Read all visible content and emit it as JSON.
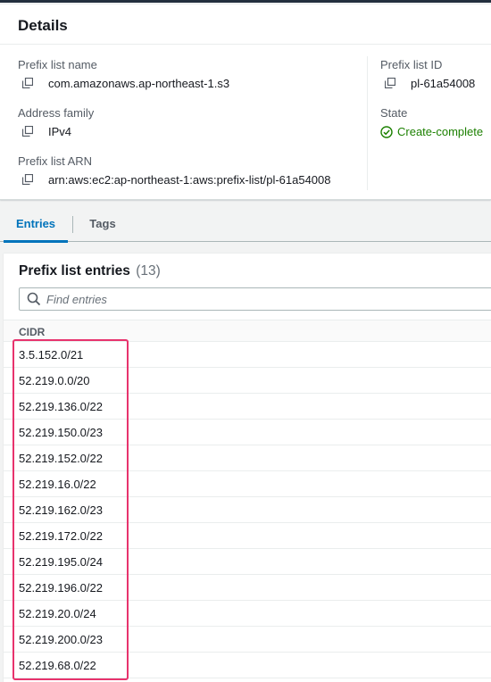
{
  "details": {
    "title": "Details",
    "prefix_list_name_label": "Prefix list name",
    "prefix_list_name": "com.amazonaws.ap-northeast-1.s3",
    "address_family_label": "Address family",
    "address_family": "IPv4",
    "prefix_list_arn_label": "Prefix list ARN",
    "prefix_list_arn": "arn:aws:ec2:ap-northeast-1:aws:prefix-list/pl-61a54008",
    "prefix_list_id_label": "Prefix list ID",
    "prefix_list_id": "pl-61a54008",
    "state_label": "State",
    "state": "Create-complete"
  },
  "tabs": [
    {
      "label": "Entries",
      "active": true
    },
    {
      "label": "Tags",
      "active": false
    }
  ],
  "entries": {
    "title": "Prefix list entries",
    "count": "(13)",
    "search_placeholder": "Find entries",
    "column_header": "CIDR",
    "rows": [
      "3.5.152.0/21",
      "52.219.0.0/20",
      "52.219.136.0/22",
      "52.219.150.0/23",
      "52.219.152.0/22",
      "52.219.16.0/22",
      "52.219.162.0/23",
      "52.219.172.0/22",
      "52.219.195.0/24",
      "52.219.196.0/22",
      "52.219.20.0/24",
      "52.219.200.0/23",
      "52.219.68.0/22"
    ]
  },
  "colors": {
    "link_blue": "#0073bb",
    "success_green": "#1d8102",
    "highlight_pink": "#e8336d"
  },
  "icons": [
    "copy-icon",
    "check-circle-icon",
    "search-icon"
  ]
}
